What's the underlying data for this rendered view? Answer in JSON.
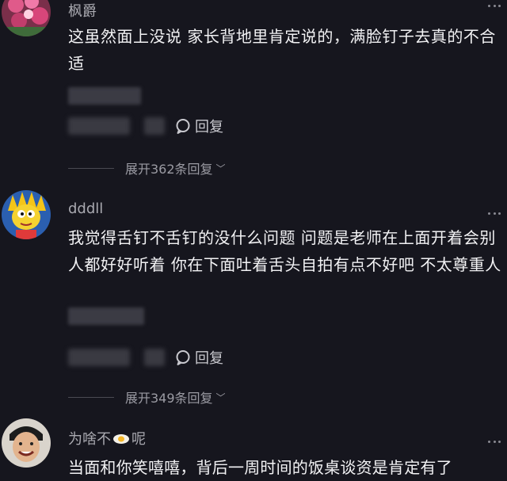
{
  "comments": [
    {
      "username": "枫爵",
      "text": "这虽然面上没说 家长背地里肯定说的，满脸钉子去真的不合适",
      "reply_label": "回复",
      "expand_label": "展开362条回复"
    },
    {
      "username": "dddll",
      "text": "我觉得舌钉不舌钉的没什么问题 问题是老师在上面开着会别人都好好听着 你在下面吐着舌头自拍有点不好吧 不太尊重人",
      "reply_label": "回复",
      "expand_label": "展开349条回复"
    },
    {
      "username": "为啥不",
      "username_suffix": "呢",
      "text": "当面和你笑嘻嘻，背后一周时间的饭桌谈资是肯定有了"
    }
  ],
  "colors": {
    "background": "#16161e",
    "text": "#f2f2f4",
    "muted": "#9b9ba3"
  }
}
